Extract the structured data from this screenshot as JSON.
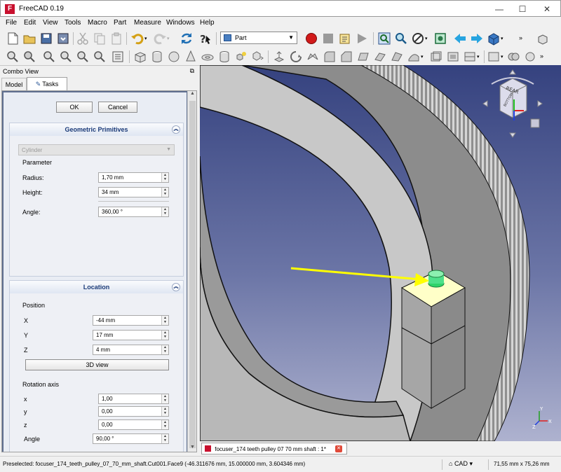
{
  "window": {
    "title": "FreeCAD 0.19",
    "minimize_glyph": "—",
    "maximize_glyph": "☐",
    "close_glyph": "✕"
  },
  "menu": {
    "items": [
      "File",
      "Edit",
      "View",
      "Tools",
      "Macro",
      "Part",
      "Measure",
      "Windows",
      "Help"
    ]
  },
  "toolbar": {
    "workbench": "Part"
  },
  "combo_view": {
    "title": "Combo View",
    "tabs": [
      "Model",
      "Tasks"
    ],
    "ok_label": "OK",
    "cancel_label": "Cancel"
  },
  "primitives": {
    "title": "Geometric Primitives",
    "type": "Cylinder",
    "parameter_label": "Parameter",
    "radius_label": "Radius:",
    "radius_value": "1,70 mm",
    "height_label": "Height:",
    "height_value": "34 mm",
    "angle_label": "Angle:",
    "angle_value": "360,00 °"
  },
  "location": {
    "title": "Location",
    "position_label": "Position",
    "x_label": "X",
    "x_value": "-44 mm",
    "y_label": "Y",
    "y_value": "17 mm",
    "z_label": "Z",
    "z_value": "4 mm",
    "view3d_label": "3D view",
    "rotation_label": "Rotation axis",
    "rx_label": "x",
    "rx_value": "1,00",
    "ry_label": "y",
    "ry_value": "0,00",
    "rz_label": "z",
    "rz_value": "0,00",
    "rangle_label": "Angle",
    "rangle_value": "90,00 °"
  },
  "viewport": {
    "navcube_face": "REAR",
    "navcube_side": "BOTTOM",
    "axis_x": "X",
    "axis_y": "Y",
    "axis_z": "Z",
    "highlight_color": "#ffff00"
  },
  "document_tab": {
    "label": "focuser_174 teeth pulley 07 70 mm shaft : 1*"
  },
  "status": {
    "message": "Preselected: focuser_174_teeth_pulley_07_70_mm_shaft.Cut001.Face9 (-46.311676 mm, 15.000000 mm, 3.604346 mm)",
    "navigation": "CAD",
    "dimensions": "71,55 mm x 75,26 mm"
  }
}
